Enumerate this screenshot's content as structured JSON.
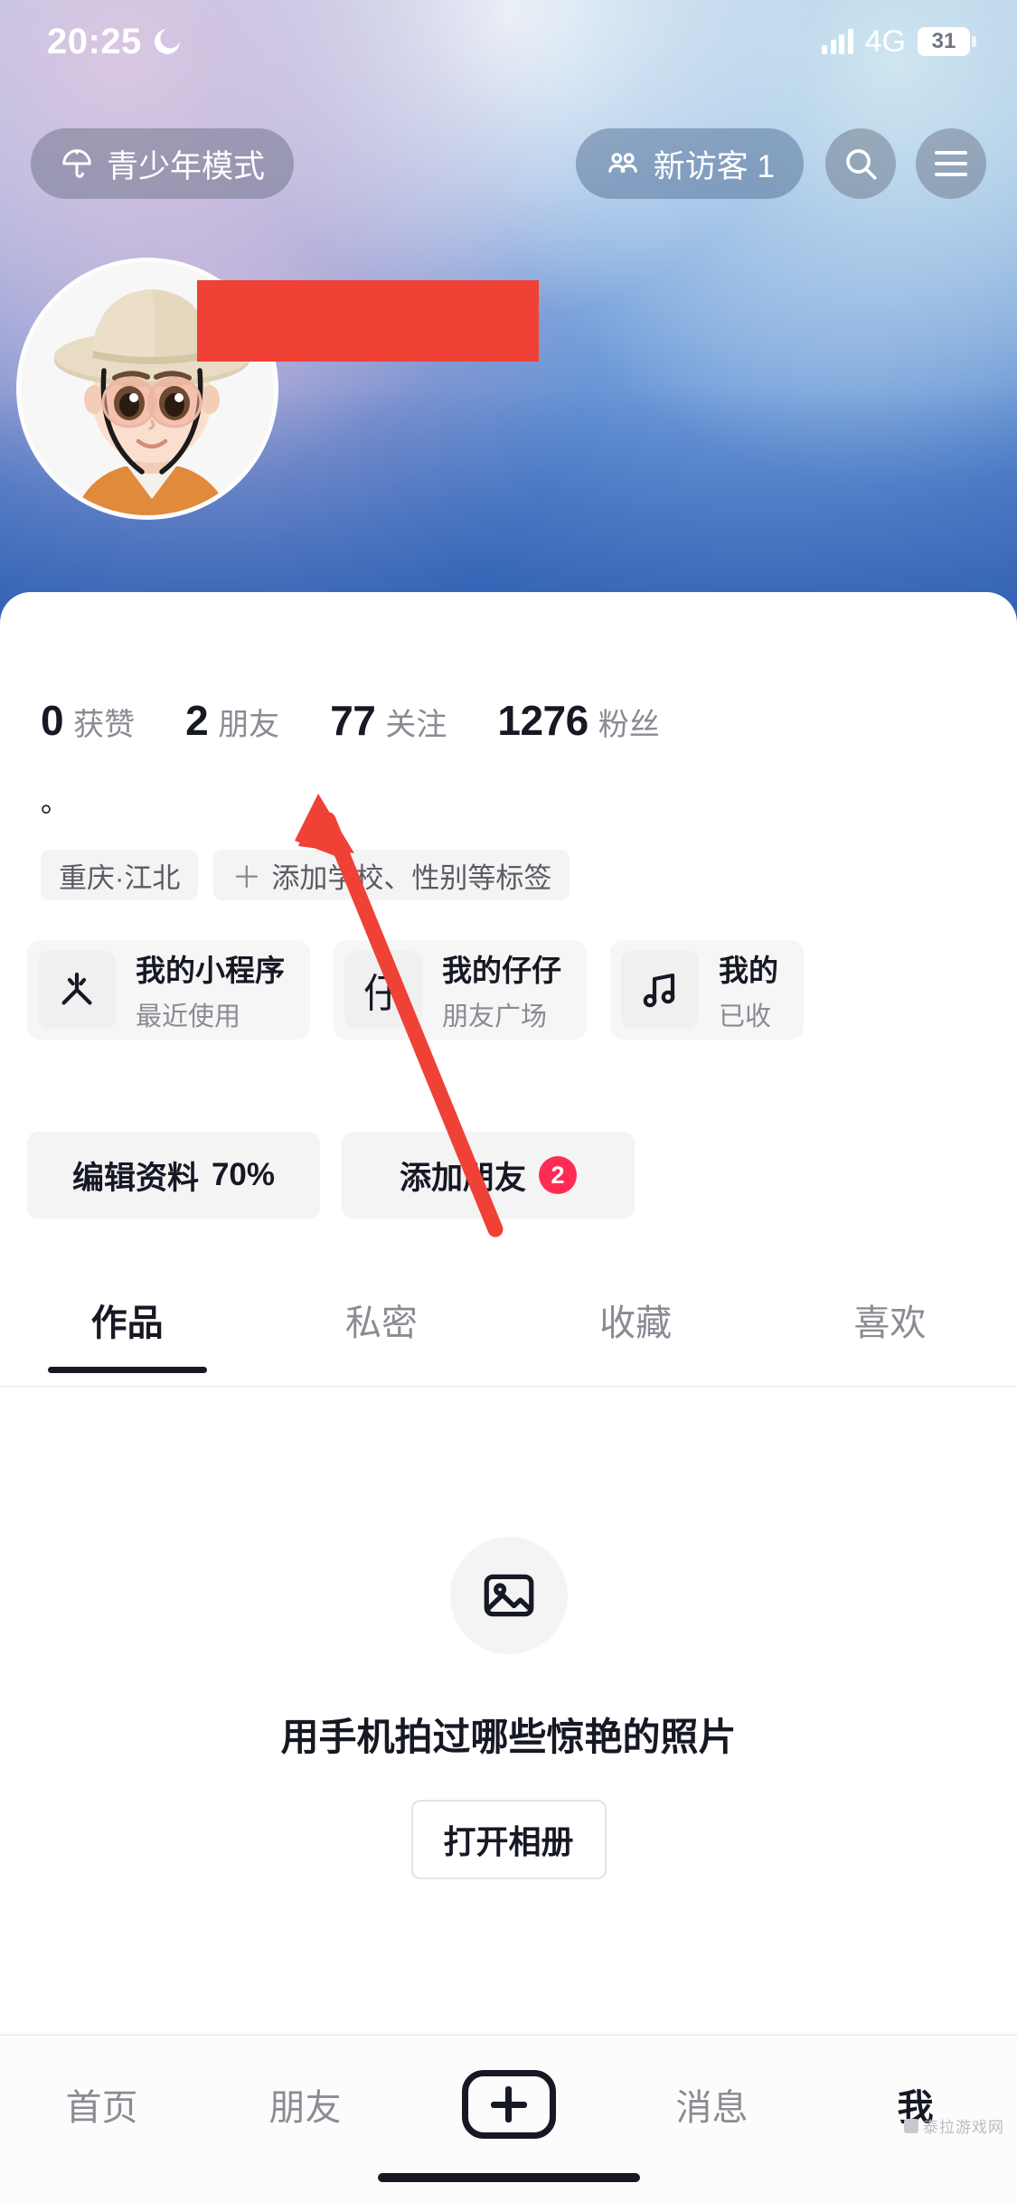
{
  "status_bar": {
    "time": "20:25",
    "moon_icon": "crescent-moon-icon",
    "signal_icon": "signal-bars-icon",
    "network": "4G",
    "battery": "31"
  },
  "top_nav": {
    "teen_mode": {
      "label": "青少年模式",
      "icon": "umbrella-icon"
    },
    "visitors": {
      "label": "新访客 1",
      "icon": "people-icon"
    },
    "search": {
      "icon": "search-icon"
    },
    "menu": {
      "icon": "hamburger-menu-icon"
    }
  },
  "profile": {
    "avatar": "user-avatar-cartoon",
    "name_redacted": true,
    "redaction_color": "#ef4136",
    "bio": "。",
    "stats": [
      {
        "num": "0",
        "label": "获赞"
      },
      {
        "num": "2",
        "label": "朋友"
      },
      {
        "num": "77",
        "label": "关注"
      },
      {
        "num": "1276",
        "label": "粉丝"
      }
    ],
    "tags": [
      {
        "text": "重庆·江北",
        "has_plus": false
      },
      {
        "text": "添加学校、性别等标签",
        "has_plus": true,
        "plus": "＋"
      }
    ]
  },
  "mini_cards": [
    {
      "icon": "asterisk-star-icon",
      "title": "我的小程序",
      "subtitle": "最近使用"
    },
    {
      "icon": "zaizai-character-icon",
      "icon_text": "仔",
      "title": "我的仔仔",
      "subtitle": "朋友广场"
    },
    {
      "icon": "music-note-icon",
      "title": "我的",
      "subtitle": "已收"
    }
  ],
  "actions": [
    {
      "label": "编辑资料",
      "value": "70%",
      "badge": null
    },
    {
      "label": "添加朋友",
      "value": "",
      "badge": "2"
    }
  ],
  "tabs": [
    {
      "label": "作品",
      "active": true
    },
    {
      "label": "私密",
      "active": false
    },
    {
      "label": "收藏",
      "active": false
    },
    {
      "label": "喜欢",
      "active": false
    }
  ],
  "empty_state": {
    "icon": "photo-image-icon",
    "prompt": "用手机拍过哪些惊艳的照片",
    "button": "打开相册"
  },
  "bottom_nav": [
    {
      "label": "首页",
      "active": false
    },
    {
      "label": "朋友",
      "active": false
    },
    {
      "label": "+",
      "active": false,
      "is_plus": true
    },
    {
      "label": "消息",
      "active": false
    },
    {
      "label": "我",
      "active": true
    }
  ],
  "annotation": {
    "arrow_color": "#ef4136",
    "points_to": "编辑资料 70%"
  },
  "watermark": "泰拉游戏网"
}
